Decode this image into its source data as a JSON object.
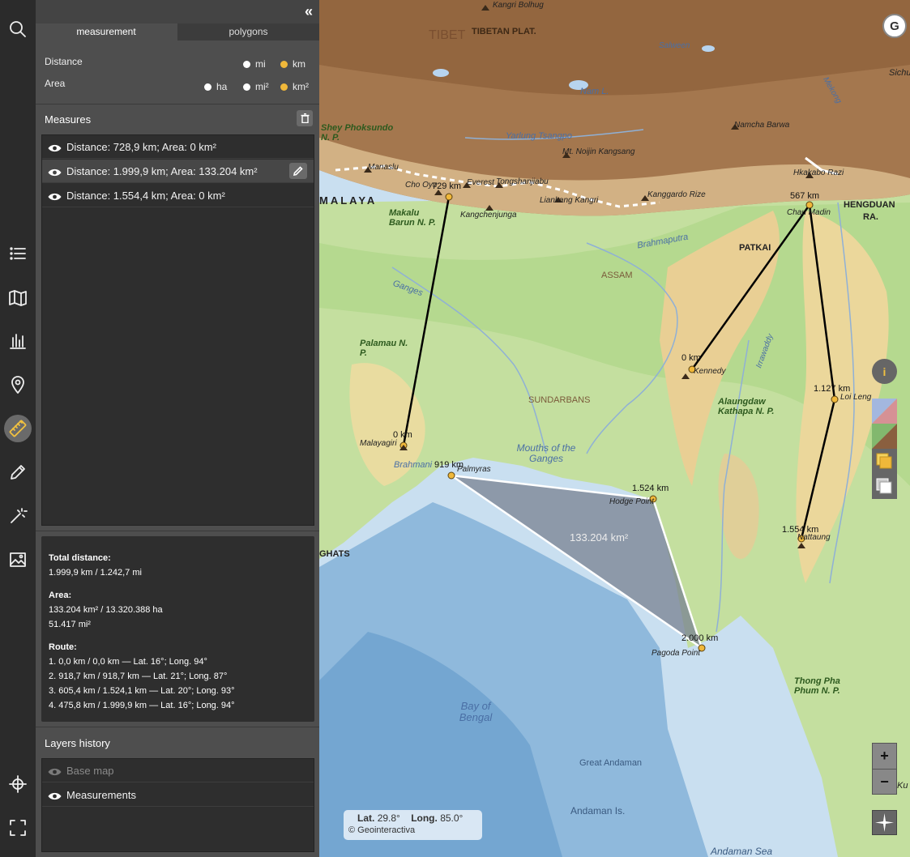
{
  "panel": {
    "collapse_label": "«",
    "tabs": [
      "measurement",
      "polygons"
    ],
    "distance_label": "Distance",
    "distance_units": [
      "mi",
      "km"
    ],
    "area_label": "Area",
    "area_units": [
      "ha",
      "mi²",
      "km²"
    ],
    "measures_title": "Measures",
    "measures": [
      "Distance: 728,9 km; Area: 0 km²",
      "Distance: 1.999,9 km; Area: 133.204 km²",
      "Distance: 1.554,4 km; Area: 0 km²"
    ],
    "info": {
      "total_distance_label": "Total distance:",
      "total_distance_value": "1.999,9 km / 1.242,7 mi",
      "area_label": "Area:",
      "area_value_1": "133.204 km² / 13.320.388 ha",
      "area_value_2": "51.417 mi²",
      "route_label": "Route:",
      "route": [
        "1. 0,0 km / 0,0 km — Lat. 16°; Long. 94°",
        "2. 918,7 km / 918,7 km — Lat. 21°; Long. 87°",
        "3. 605,4 km / 1.524,1 km — Lat. 20°; Long. 93°",
        "4. 475,8 km / 1.999,9 km — Lat. 16°; Long. 94°"
      ]
    },
    "layers_title": "Layers history",
    "layers": [
      "Base map",
      "Measurements"
    ]
  },
  "toolbar_icons": [
    "search-icon",
    "list-icon",
    "map-icon",
    "chart-icon",
    "location-pin-icon",
    "ruler-icon",
    "pencil-icon",
    "magic-wand-icon",
    "image-icon",
    "crosshair-icon",
    "fullscreen-icon"
  ],
  "map": {
    "regions": [
      "TIBET",
      "TIBETAN PLAT.",
      "MALAYA",
      "ASSAM",
      "PATKAI",
      "SUNDARBANS",
      "HENGDUAN",
      "RA.",
      "GHATS"
    ],
    "peaks": [
      "Kangri Bolhug",
      "Namcha Barwa",
      "Mt. Noijin Kangsang",
      "Manaslu",
      "Cho Oyu",
      "Everest",
      "Tongshanjiabu",
      "Kangchenjunga",
      "Liankang Kangri",
      "Kanggardo Rize",
      "Hkakabo Razi",
      "Chau Madin",
      "Kennedy",
      "Loi Leng",
      "Malayagiri",
      "Palmyras",
      "Nattaung"
    ],
    "places": [
      "Shey Phoksundo N. P.",
      "Makalu Barun N. P.",
      "Palamau N. P.",
      "Alaungdaw Kathapa N. P.",
      "Thong Pha Phum N. P.",
      "Hodge Point",
      "Pagoda Point",
      "Great Andaman",
      "Andaman Is.",
      "Sichu",
      "Ku"
    ],
    "water": [
      "Salween",
      "Nam L.",
      "Yarlung Tsangpo",
      "Mekong",
      "Brahmaputra",
      "Ganges",
      "Irrawaddy",
      "Brahmani",
      "Mouths of the Ganges",
      "Bay of Bengal",
      "Andaman Sea"
    ],
    "measure_labels": [
      "729 km",
      "0 km",
      "919 km",
      "1.524 km",
      "2.000 km",
      "133.204 km²",
      "567 km",
      "0 km",
      "1.127 km",
      "1.554 km"
    ],
    "coords": {
      "lat_label": "Lat.",
      "lat": "29.8°",
      "long_label": "Long.",
      "long": "85.0°"
    },
    "copyright": "© Geointeractiva",
    "zoom_in": "+",
    "zoom_out": "−",
    "info_button": "i",
    "logo": "G"
  }
}
